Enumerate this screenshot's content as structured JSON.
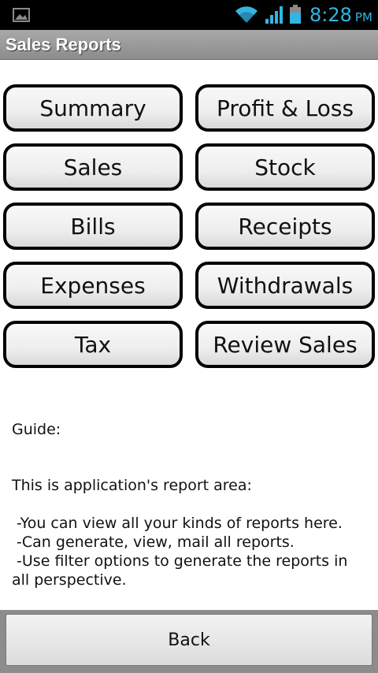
{
  "status_bar": {
    "time": "8:28",
    "ampm": "PM",
    "accent_color": "#33b5e5",
    "icons": [
      "image-icon",
      "wifi-icon",
      "signal-icon",
      "battery-icon"
    ]
  },
  "title_bar": {
    "title": "Sales Reports"
  },
  "reports": {
    "buttons": [
      {
        "label": "Summary"
      },
      {
        "label": "Profit & Loss"
      },
      {
        "label": "Sales"
      },
      {
        "label": "Stock"
      },
      {
        "label": "Bills"
      },
      {
        "label": "Receipts"
      },
      {
        "label": "Expenses"
      },
      {
        "label": "Withdrawals"
      },
      {
        "label": "Tax"
      },
      {
        "label": "Review Sales"
      }
    ]
  },
  "guide": {
    "heading": "Guide:",
    "intro": "This is application's report area:",
    "points": [
      " -You can view all your kinds of reports here.",
      " -Can generate, view, mail all reports.",
      " -Use filter options to generate the reports in all perspective."
    ]
  },
  "footer": {
    "back_label": "Back"
  }
}
